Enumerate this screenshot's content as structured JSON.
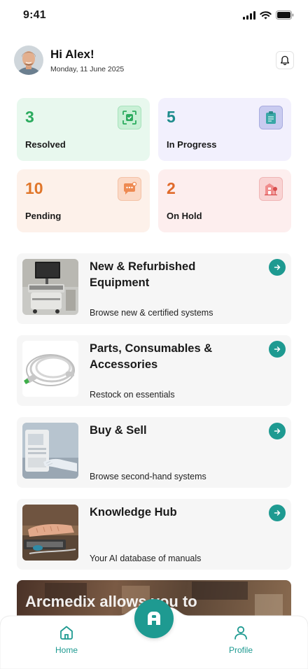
{
  "status_bar": {
    "time": "9:41"
  },
  "header": {
    "greeting": "Hi Alex!",
    "date": "Monday, 11 June 2025"
  },
  "stats": [
    {
      "value": "3",
      "label": "Resolved",
      "icon": "scan-check-icon",
      "color": "#2bab5e",
      "bg": "#e8f8ee"
    },
    {
      "value": "5",
      "label": "In Progress",
      "icon": "clipboard-icon",
      "color": "#1e8c8c",
      "bg": "#f2f0fd"
    },
    {
      "value": "10",
      "label": "Pending",
      "icon": "chat-dots-icon",
      "color": "#e0762a",
      "bg": "#fdf1ea"
    },
    {
      "value": "2",
      "label": "On Hold",
      "icon": "building-icon",
      "color": "#e06a2a",
      "bg": "#fdeeee"
    }
  ],
  "categories": [
    {
      "title": "New & Refurbished Equipment",
      "subtitle": "Browse new & certified systems"
    },
    {
      "title": "Parts, Consumables & Accessories",
      "subtitle": "Restock on essentials"
    },
    {
      "title": "Buy & Sell",
      "subtitle": "Browse second-hand systems"
    },
    {
      "title": "Knowledge Hub",
      "subtitle": "Your AI database of manuals"
    }
  ],
  "banner": {
    "text": "Arcmedix allows you to"
  },
  "nav": {
    "home_label": "Home",
    "profile_label": "Profile"
  },
  "colors": {
    "accent": "#1e9a91",
    "card_bg": "#f6f6f6"
  }
}
